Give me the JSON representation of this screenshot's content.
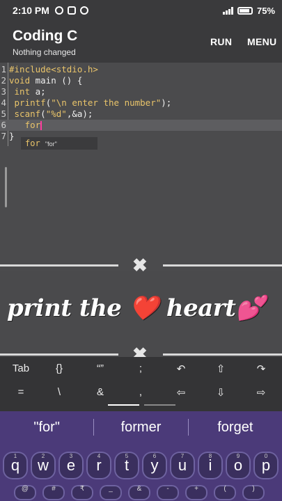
{
  "status": {
    "time": "2:10 PM",
    "battery": "75"
  },
  "app": {
    "title": "Coding C",
    "subtitle": "Nothing changed",
    "run": "RUN",
    "menu": "MENU"
  },
  "editor": {
    "lines": [
      {
        "n": "1",
        "parts": [
          [
            "kw",
            "#include<stdio.h>"
          ]
        ]
      },
      {
        "n": "2",
        "parts": [
          [
            "kw",
            "void"
          ],
          [
            "pl",
            " main () {"
          ]
        ]
      },
      {
        "n": "3",
        "parts": [
          [
            "pl",
            " "
          ],
          [
            "kw",
            "int"
          ],
          [
            "pl",
            " a;"
          ]
        ]
      },
      {
        "n": "4",
        "parts": [
          [
            "pl",
            " "
          ],
          [
            "kw",
            "printf"
          ],
          [
            "pl",
            "("
          ],
          [
            "str",
            "\"\\n enter the number\""
          ],
          [
            "pl",
            ");"
          ]
        ]
      },
      {
        "n": "5",
        "parts": [
          [
            "pl",
            " "
          ],
          [
            "kw",
            "scanf"
          ],
          [
            "pl",
            "("
          ],
          [
            "str",
            "\"%d\""
          ],
          [
            "pl",
            ",&a);"
          ]
        ]
      },
      {
        "n": "6",
        "parts": [
          [
            "pl",
            "   "
          ],
          [
            "kw",
            "for"
          ]
        ]
      },
      {
        "n": "7",
        "parts": [
          [
            "pl",
            "}"
          ]
        ]
      }
    ],
    "suggestion_keyword": "for",
    "suggestion_hint": "\"for\""
  },
  "caption": "print the ❤️ heart💕",
  "symbols_row1": [
    "Tab",
    "{}",
    "“”",
    ";",
    "↶",
    "⇧",
    "↷"
  ],
  "symbols_row2": [
    "=",
    "\\",
    "&",
    ",",
    "⇦",
    "⇩",
    "⇨"
  ],
  "keyboard": {
    "suggestions": [
      "\"for\"",
      "former",
      "forget"
    ],
    "row1": [
      {
        "k": "q",
        "s": "1"
      },
      {
        "k": "w",
        "s": "2"
      },
      {
        "k": "e",
        "s": "3"
      },
      {
        "k": "r",
        "s": "4"
      },
      {
        "k": "t",
        "s": "5"
      },
      {
        "k": "y",
        "s": "6"
      },
      {
        "k": "u",
        "s": "7"
      },
      {
        "k": "i",
        "s": "8"
      },
      {
        "k": "o",
        "s": "9"
      },
      {
        "k": "p",
        "s": "0"
      }
    ],
    "row2": [
      "@",
      "#",
      "₹",
      "_",
      "&",
      "-",
      "+",
      "(",
      ")"
    ]
  },
  "colors": {
    "accent": "#ff3da0",
    "keyword": "#e9c46a",
    "keyboard_bg": "#4b3a79"
  }
}
